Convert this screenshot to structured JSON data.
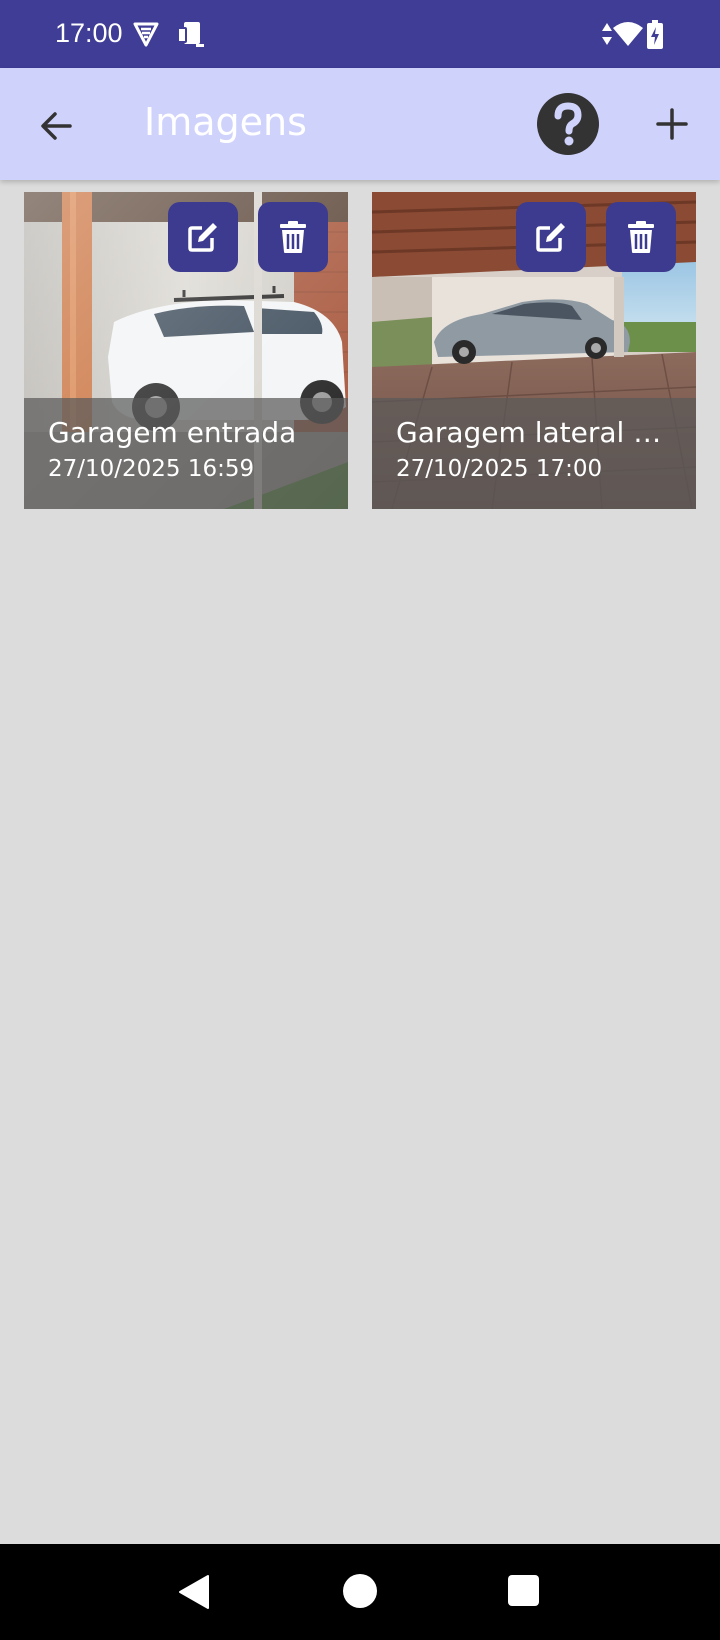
{
  "status_bar": {
    "time": "17:00",
    "icons": [
      "vpn-shield-icon",
      "device-sync-icon",
      "data-arrows-icon",
      "wifi-icon",
      "battery-charging-icon"
    ]
  },
  "app_bar": {
    "title": "Imagens",
    "back_icon": "arrow-left-icon",
    "help_icon": "help-circle-icon",
    "add_icon": "plus-icon"
  },
  "images": [
    {
      "title": "Garagem entrada",
      "date": "27/10/2025 16:59"
    },
    {
      "title": "Garagem lateral s...",
      "date": "27/10/2025 17:00"
    }
  ],
  "colors": {
    "status_bar": "#3f3d96",
    "app_bar": "#cfd2fb",
    "accent": "#3d3b8f",
    "background": "#dcdcdc"
  },
  "nav_bar": {
    "icons": [
      "back-triangle-icon",
      "home-circle-icon",
      "recents-square-icon"
    ]
  }
}
